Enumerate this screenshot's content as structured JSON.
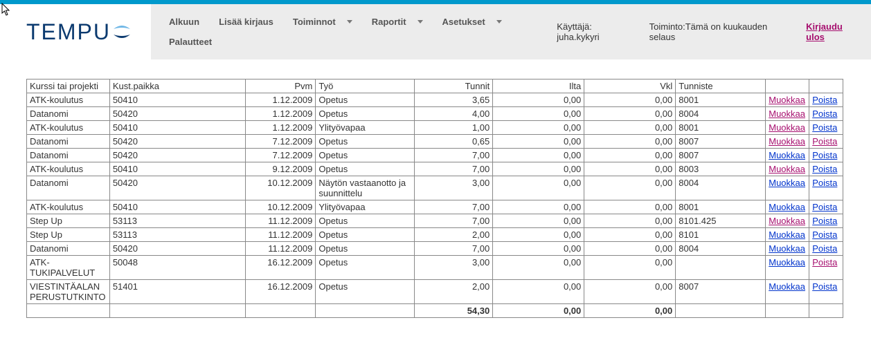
{
  "brand": "TEMPU",
  "nav": {
    "alkuun": "Alkuun",
    "lisaa": "Lisää kirjaus",
    "toiminnot": "Toiminnot",
    "raportit": "Raportit",
    "asetukset": "Asetukset",
    "palautteet": "Palautteet"
  },
  "status": {
    "user_label": "Käyttäjä: ",
    "user_value": "juha.kykyri",
    "toiminto_label": "Toiminto:",
    "toiminto_value": "Tämä on kuukauden selaus"
  },
  "logout": "Kirjaudu ulos",
  "table": {
    "headers": {
      "kurssi": "Kurssi tai projekti",
      "kust": "Kust.paikka",
      "pvm": "Pvm",
      "tyo": "Työ",
      "tunnit": "Tunnit",
      "ilta": "Ilta",
      "vkl": "Vkl",
      "tunniste": "Tunniste"
    },
    "actions": {
      "edit": "Muokkaa",
      "del": "Poista"
    },
    "rows": [
      {
        "kurssi": "ATK-koulutus",
        "kust": "50410",
        "pvm": "1.12.2009",
        "tyo": "Opetus",
        "tunnit": "3,65",
        "ilta": "0,00",
        "vkl": "0,00",
        "tunniste": "8001",
        "edit_visited": true,
        "del_visited": false
      },
      {
        "kurssi": "Datanomi",
        "kust": "50420",
        "pvm": "1.12.2009",
        "tyo": "Opetus",
        "tunnit": "4,00",
        "ilta": "0,00",
        "vkl": "0,00",
        "tunniste": "8004",
        "edit_visited": true,
        "del_visited": false
      },
      {
        "kurssi": "ATK-koulutus",
        "kust": "50410",
        "pvm": "1.12.2009",
        "tyo": "Ylityövapaa",
        "tunnit": "1,00",
        "ilta": "0,00",
        "vkl": "0,00",
        "tunniste": "8001",
        "edit_visited": true,
        "del_visited": false
      },
      {
        "kurssi": "Datanomi",
        "kust": "50420",
        "pvm": "7.12.2009",
        "tyo": "Opetus",
        "tunnit": "0,65",
        "ilta": "0,00",
        "vkl": "0,00",
        "tunniste": "8007",
        "edit_visited": true,
        "del_visited": true
      },
      {
        "kurssi": "Datanomi",
        "kust": "50420",
        "pvm": "7.12.2009",
        "tyo": "Opetus",
        "tunnit": "7,00",
        "ilta": "0,00",
        "vkl": "0,00",
        "tunniste": "8007",
        "edit_visited": false,
        "del_visited": false
      },
      {
        "kurssi": "ATK-koulutus",
        "kust": "50410",
        "pvm": "9.12.2009",
        "tyo": "Opetus",
        "tunnit": "7,00",
        "ilta": "0,00",
        "vkl": "0,00",
        "tunniste": "8003",
        "edit_visited": true,
        "del_visited": false
      },
      {
        "kurssi": "Datanomi",
        "kust": "50420",
        "pvm": "10.12.2009",
        "tyo": "Näytön vastaanotto ja suunnittelu",
        "tunnit": "3,00",
        "ilta": "0,00",
        "vkl": "0,00",
        "tunniste": "8004",
        "edit_visited": false,
        "del_visited": false
      },
      {
        "kurssi": "ATK-koulutus",
        "kust": "50410",
        "pvm": "10.12.2009",
        "tyo": "Ylityövapaa",
        "tunnit": "7,00",
        "ilta": "0,00",
        "vkl": "0,00",
        "tunniste": "8001",
        "edit_visited": false,
        "del_visited": false
      },
      {
        "kurssi": "Step Up",
        "kust": "53113",
        "pvm": "11.12.2009",
        "tyo": "Opetus",
        "tunnit": "7,00",
        "ilta": "0,00",
        "vkl": "0,00",
        "tunniste": "8101.425",
        "edit_visited": true,
        "del_visited": false
      },
      {
        "kurssi": "Step Up",
        "kust": "53113",
        "pvm": "11.12.2009",
        "tyo": "Opetus",
        "tunnit": "2,00",
        "ilta": "0,00",
        "vkl": "0,00",
        "tunniste": "8101",
        "edit_visited": false,
        "del_visited": false
      },
      {
        "kurssi": "Datanomi",
        "kust": "50420",
        "pvm": "11.12.2009",
        "tyo": "Opetus",
        "tunnit": "7,00",
        "ilta": "0,00",
        "vkl": "0,00",
        "tunniste": "8004",
        "edit_visited": false,
        "del_visited": false
      },
      {
        "kurssi": "ATK-TUKIPALVELUT",
        "kust": "50048",
        "pvm": "16.12.2009",
        "tyo": "Opetus",
        "tunnit": "3,00",
        "ilta": "0,00",
        "vkl": "0,00",
        "tunniste": "",
        "edit_visited": false,
        "del_visited": true
      },
      {
        "kurssi": "VIESTINTÄALAN PERUSTUTKINTO",
        "kust": "51401",
        "pvm": "16.12.2009",
        "tyo": "Opetus",
        "tunnit": "2,00",
        "ilta": "0,00",
        "vkl": "0,00",
        "tunniste": "8007",
        "edit_visited": false,
        "del_visited": false
      }
    ],
    "totals": {
      "tunnit": "54,30",
      "ilta": "0,00",
      "vkl": "0,00"
    }
  }
}
